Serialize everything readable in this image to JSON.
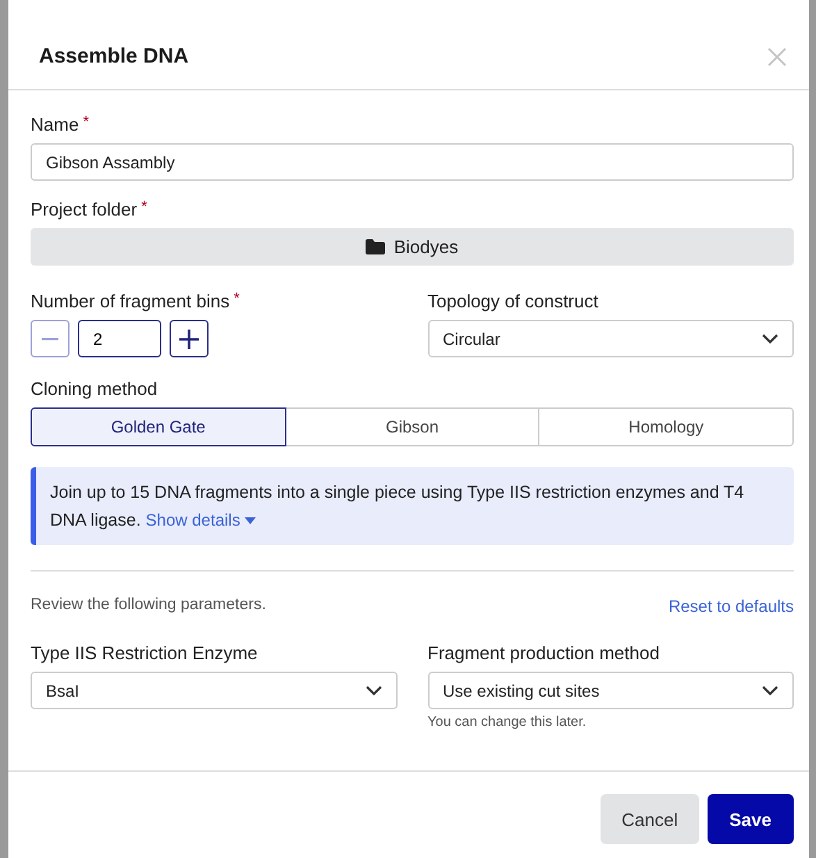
{
  "dialog": {
    "title": "Assemble DNA"
  },
  "name_field": {
    "label": "Name",
    "required_mark": "*",
    "value": "Gibson Assambly"
  },
  "project_folder": {
    "label": "Project folder",
    "required_mark": "*",
    "value": "Biodyes"
  },
  "fragment_bins": {
    "label": "Number of fragment bins",
    "required_mark": "*",
    "value": "2",
    "decrement_disabled": true
  },
  "topology": {
    "label": "Topology of construct",
    "value": "Circular"
  },
  "cloning_method": {
    "label": "Cloning method",
    "options": [
      {
        "label": "Golden Gate",
        "selected": true
      },
      {
        "label": "Gibson",
        "selected": false
      },
      {
        "label": "Homology",
        "selected": false
      }
    ]
  },
  "info": {
    "text": "Join up to 15 DNA fragments into a single piece using Type IIS restriction enzymes and T4 DNA ligase.",
    "link": "Show details"
  },
  "review": {
    "text": "Review the following parameters.",
    "link": "Reset to defaults"
  },
  "params": [
    {
      "label": "Type IIS Restriction Enzyme",
      "value": "BsaI"
    },
    {
      "label": "Fragment production method",
      "value": "Use existing cut sites",
      "hint": "You can change this later."
    }
  ],
  "buttons": [
    {
      "label": "Cancel",
      "kind": "secondary"
    },
    {
      "label": "Save",
      "kind": "primary"
    }
  ]
}
